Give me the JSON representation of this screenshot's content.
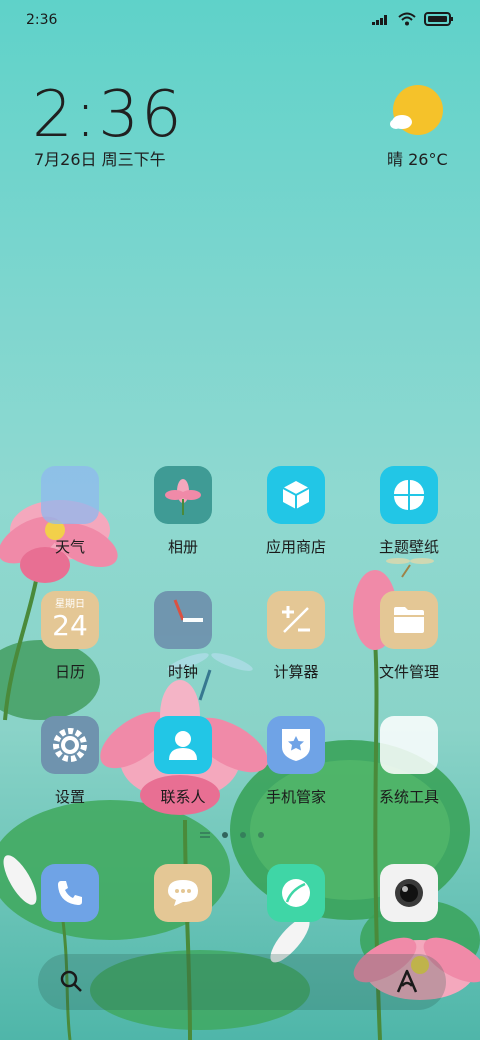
{
  "status_bar": {
    "time": "2:36"
  },
  "clock_widget": {
    "time": "2:36",
    "date": "7月26日 周三下午"
  },
  "weather_widget": {
    "text": "晴 26°C",
    "icon": "sunny-partly-cloudy-icon"
  },
  "apps": [
    {
      "label": "天气",
      "icon": "weather-icon",
      "color": "#8fb8ef"
    },
    {
      "label": "相册",
      "icon": "gallery-icon",
      "color": "#3f9b95"
    },
    {
      "label": "应用商店",
      "icon": "app-store-icon",
      "color": "#22c6e6"
    },
    {
      "label": "主题壁纸",
      "icon": "themes-icon",
      "color": "#22c6e6"
    },
    {
      "label": "日历",
      "icon": "calendar-icon",
      "color": "#e4c795",
      "calendar_weekday": "星期日",
      "calendar_day": "24"
    },
    {
      "label": "时钟",
      "icon": "clock-icon",
      "color": "#6f93ae"
    },
    {
      "label": "计算器",
      "icon": "calculator-icon",
      "color": "#e4c795"
    },
    {
      "label": "文件管理",
      "icon": "file-manager-icon",
      "color": "#e4c795"
    },
    {
      "label": "设置",
      "icon": "settings-icon",
      "color": "#6f93ae"
    },
    {
      "label": "联系人",
      "icon": "contacts-icon",
      "color": "#22c6e6"
    },
    {
      "label": "手机管家",
      "icon": "security-icon",
      "color": "#6fa3e6"
    },
    {
      "label": "系统工具",
      "icon": "system-tools-folder-icon",
      "color": "#ffffff"
    }
  ],
  "dock": [
    {
      "icon": "phone-icon",
      "color": "#6fa3e6"
    },
    {
      "icon": "messages-icon",
      "color": "#e4c795"
    },
    {
      "icon": "browser-icon",
      "color": "#3fd6a6"
    },
    {
      "icon": "camera-icon",
      "color": "#f2f2f2"
    }
  ],
  "page_indicator": {
    "pages": 3,
    "current": 1
  },
  "search": {
    "icon": "search-icon",
    "assistant_icon": "assistant-icon"
  }
}
